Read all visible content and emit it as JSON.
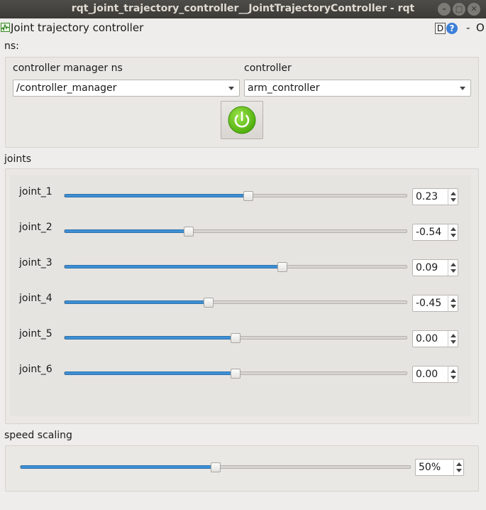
{
  "window": {
    "title": "rqt_joint_trajectory_controller__JointTrajectoryController - rqt",
    "buttons": {
      "minimize": "–",
      "maximize": "□",
      "close": "✕"
    }
  },
  "plugin": {
    "title": "Joint trajectory controller",
    "icon": "chart-icon",
    "d_button": "D",
    "help_button": "?",
    "minimize_label": "-",
    "float_label": "O"
  },
  "ns": {
    "label": "ns:",
    "controller_manager_label": "controller manager ns",
    "controller_manager_value": "/controller_manager",
    "controller_label": "controller",
    "controller_value": "arm_controller",
    "power_icon": "power-icon",
    "power_color": "#5dc313"
  },
  "joints": {
    "label": "joints",
    "items": [
      {
        "name": "joint_1",
        "value": "0.23",
        "level": 0.537
      },
      {
        "name": "joint_2",
        "value": "-0.54",
        "level": 0.364
      },
      {
        "name": "joint_3",
        "value": "0.09",
        "level": 0.636
      },
      {
        "name": "joint_4",
        "value": "-0.45",
        "level": 0.421
      },
      {
        "name": "joint_5",
        "value": "0.00",
        "level": 0.5
      },
      {
        "name": "joint_6",
        "value": "0.00",
        "level": 0.5
      }
    ]
  },
  "speed": {
    "label": "speed scaling",
    "value": "50%",
    "level": 0.5
  },
  "colors": {
    "accent": "#3e8fd4",
    "titlebar": "#3c3b37",
    "background": "#efedeb"
  }
}
